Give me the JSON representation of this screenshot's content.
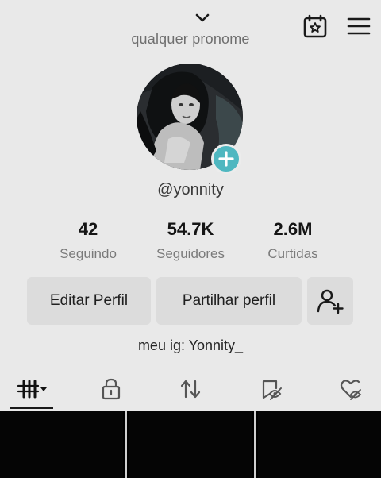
{
  "header": {
    "pronoun": "qualquer pronome",
    "icons": [
      "chevron-down-icon",
      "calendar-star-icon",
      "hamburger-menu-icon"
    ]
  },
  "profile": {
    "username": "@yonnity",
    "bio": "meu ig: Yonnity_"
  },
  "stats": [
    {
      "value": "42",
      "label": "Seguindo"
    },
    {
      "value": "54.7K",
      "label": "Seguidores"
    },
    {
      "value": "2.6M",
      "label": "Curtidas"
    }
  ],
  "actions": {
    "edit_label": "Editar Perfil",
    "share_label": "Partilhar perfil",
    "add_friend_icon": "add-user-icon"
  },
  "tabs": [
    {
      "icon": "videos-grid-icon",
      "active": true
    },
    {
      "icon": "private-lock-icon",
      "active": false
    },
    {
      "icon": "reposts-icon",
      "active": false
    },
    {
      "icon": "favorites-icon",
      "active": false
    },
    {
      "icon": "liked-hidden-icon",
      "active": false
    }
  ],
  "colors": {
    "background": "#e9e9e9",
    "accent_badge": "#4fb7c0",
    "button_bg": "#dcdcdc"
  }
}
